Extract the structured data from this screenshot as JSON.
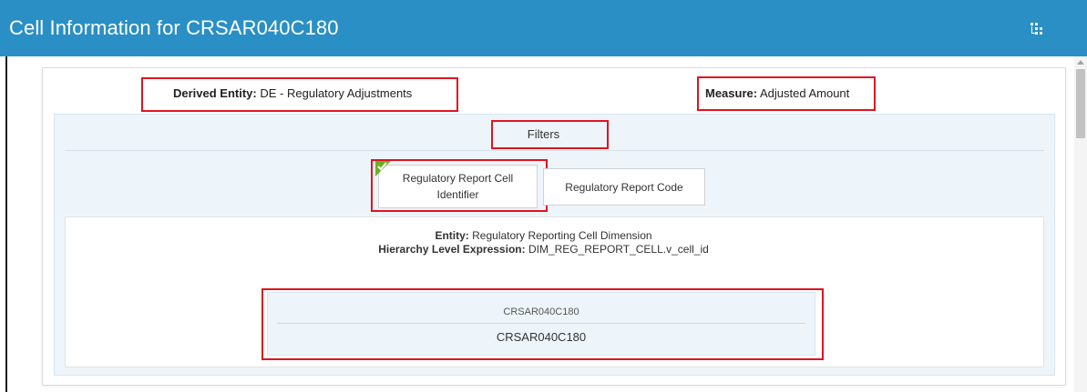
{
  "window": {
    "title": "Cell Information for CRSAR040C180",
    "header_color": "#2a8fc4",
    "header_icon": "hierarchy-icon"
  },
  "summary": {
    "derived_entity_label": "Derived Entity:",
    "derived_entity_value": "DE - Regulatory Adjustments",
    "measure_label": "Measure:",
    "measure_value": "Adjusted Amount"
  },
  "filters": {
    "title": "Filters",
    "tabs": [
      {
        "label": "Regulatory Report Cell Identifier",
        "selected": true
      },
      {
        "label": "Regulatory Report Code",
        "selected": false
      }
    ]
  },
  "detail": {
    "entity_label": "Entity:",
    "entity_value": "Regulatory Reporting Cell Dimension",
    "hierarchy_label": "Hierarchy Level Expression:",
    "hierarchy_value": "DIM_REG_REPORT_CELL.v_cell_id",
    "column_header": "CRSAR040C180",
    "values": [
      "CRSAR040C180"
    ]
  },
  "colors": {
    "highlight": "#e0141e",
    "checkmark": "#6ab023",
    "panel": "#eef5fa"
  }
}
